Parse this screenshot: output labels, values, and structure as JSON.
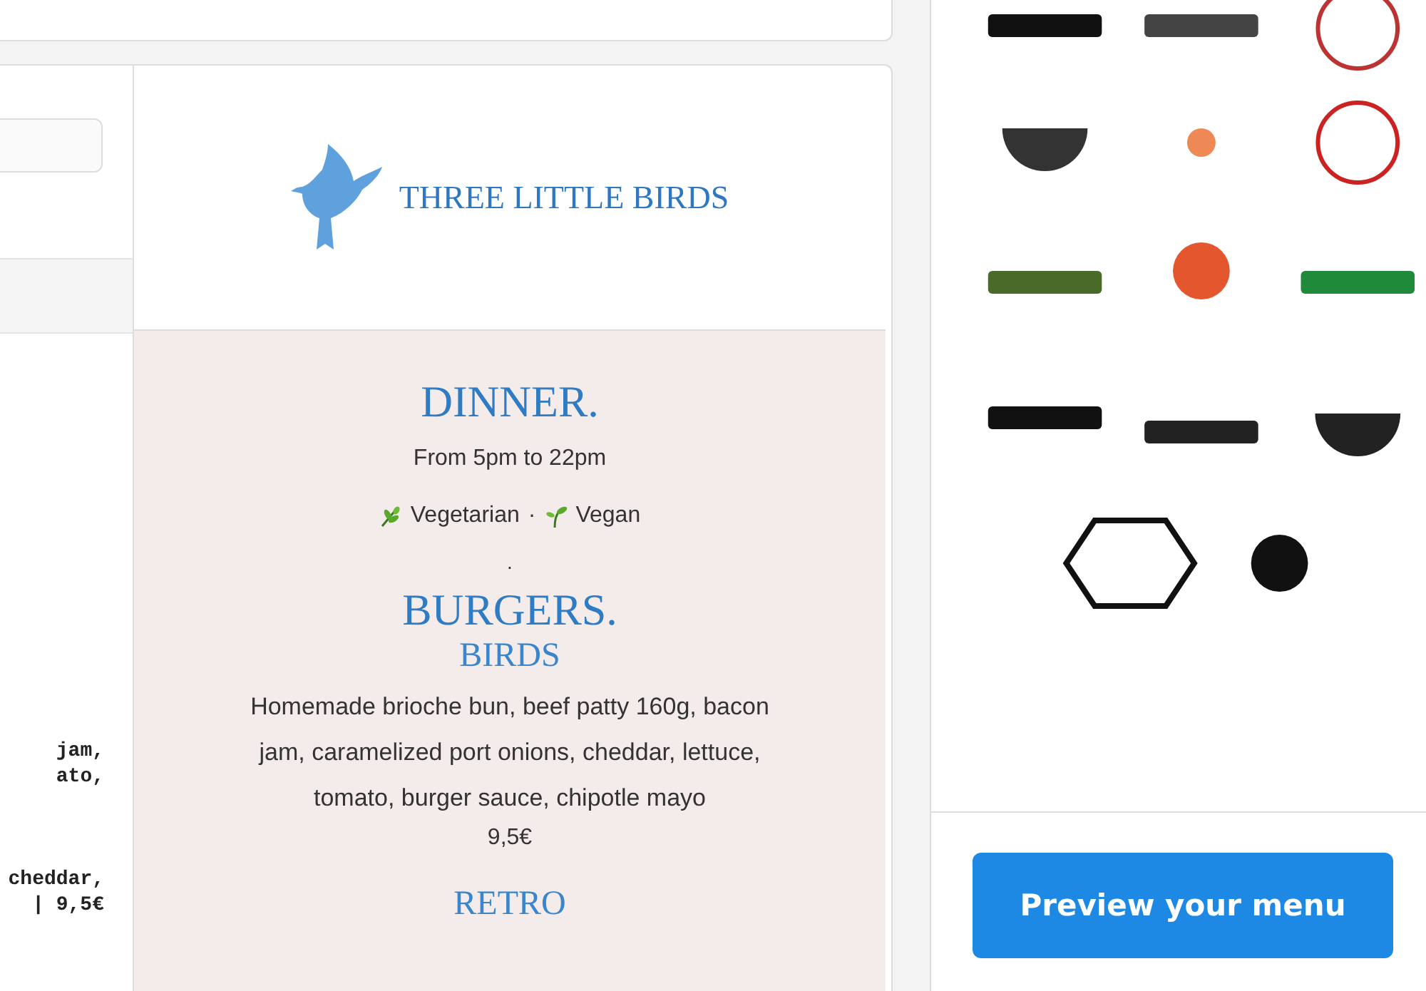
{
  "editor": {
    "code_lines": [
      "jam,",
      "ato,",
      "cheddar,",
      "| 9,5€"
    ]
  },
  "menu": {
    "brand": "THREE LITTLE BIRDS",
    "title": "DINNER.",
    "hours": "From 5pm to 22pm",
    "legend": [
      {
        "kind": "vegetarian",
        "label": "Vegetarian"
      },
      {
        "kind": "vegan",
        "label": "Vegan"
      }
    ],
    "legend_separator": "·",
    "divider": ".",
    "categories": [
      {
        "title": "BURGERS.",
        "items": [
          {
            "name": "BIRDS",
            "description": "Homemade brioche bun, beef patty 160g, bacon jam, caramelized port onions, cheddar, lettuce, tomato, burger sauce, chipotle mayo",
            "price": "9,5€"
          },
          {
            "name": "RETRO"
          }
        ]
      }
    ]
  },
  "sidebar": {
    "preview_button": "Preview your menu"
  }
}
